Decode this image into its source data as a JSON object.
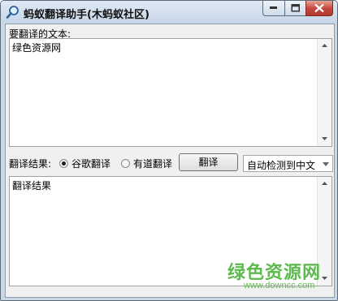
{
  "window": {
    "title": "蚂蚁翻译助手(木蚂蚁社区)",
    "icon": "search-magnifier-icon"
  },
  "source": {
    "label": "要翻译的文本:",
    "value": "绿色资源网"
  },
  "controls": {
    "result_label": "翻译结果:",
    "engines": [
      {
        "label": "谷歌翻译",
        "selected": true
      },
      {
        "label": "有道翻译",
        "selected": false
      }
    ],
    "translate_button": "翻译",
    "direction": {
      "selected": "自动检测到中文"
    }
  },
  "result": {
    "value": "翻译结果"
  },
  "watermark": {
    "text": "绿色资源网",
    "url": "www.downcc.com",
    "color": "#5dba4c"
  },
  "colors": {
    "close_button": "#c4443b",
    "titlebar": "#c6d6e8"
  }
}
